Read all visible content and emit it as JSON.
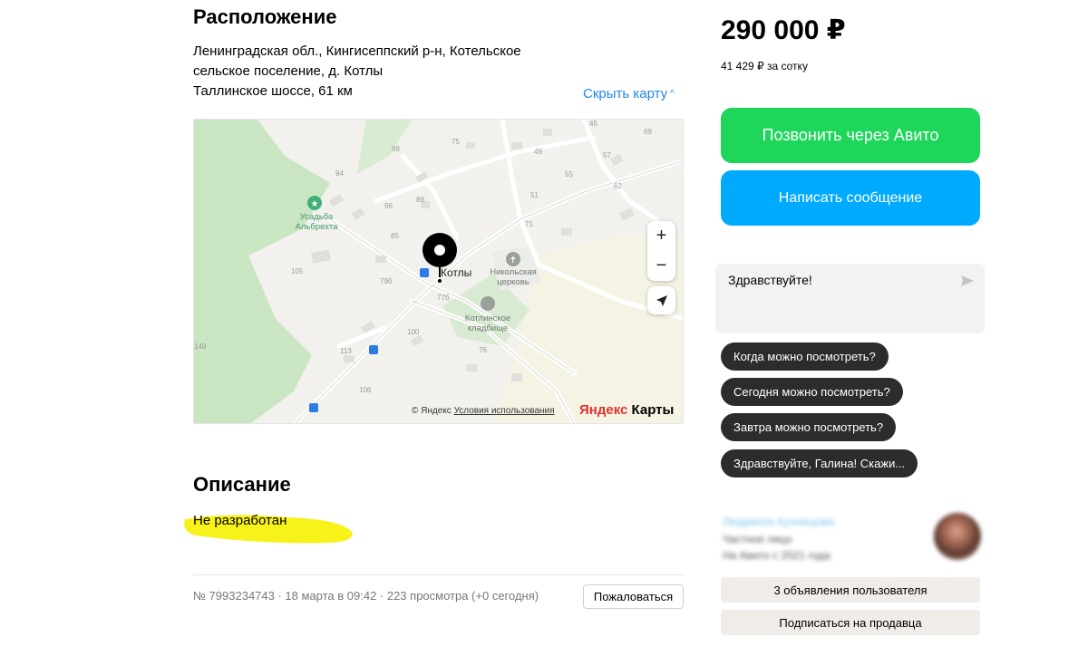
{
  "location": {
    "title": "Расположение",
    "address_line1": "Ленинградская обл., Кингисеппский р-н, Котельское",
    "address_line2": "сельское поселение, д. Котлы",
    "road": "Таллинское шоссе, 61 км",
    "hide_map_link": "Скрыть карту"
  },
  "map": {
    "place_labels": {
      "estate": "Усадьба\nАльбрехта",
      "church": "Никольская\nцерковь",
      "cemetery": "Котлинское\nкладбище",
      "village": "Котлы"
    },
    "house_numbers": [
      "45",
      "75",
      "88",
      "49",
      "57",
      "69",
      "94",
      "55",
      "62",
      "89",
      "51",
      "96",
      "71",
      "85",
      "105",
      "79б",
      "77б",
      "100",
      "149",
      "113",
      "76",
      "106"
    ],
    "zoom_in": "+",
    "zoom_out": "−",
    "copyright": "© Яндекс",
    "terms_link": "Условия использования",
    "logo_part1": "Яндекс",
    "logo_part2": "Карты"
  },
  "description": {
    "title": "Описание",
    "text": "Не разработан"
  },
  "footer": {
    "meta": "№ 7993234743 · 18 марта в 09:42 · 223 просмотра (+0 сегодня)",
    "report_button": "Пожаловаться"
  },
  "sidebar": {
    "price": "290 000 ₽",
    "price_per_unit": "41 429 ₽ за сотку",
    "call_button": "Позвонить через Авито",
    "message_button": "Написать сообщение",
    "chat_text": "Здравствуйте!",
    "quick_replies": [
      "Когда можно посмотреть?",
      "Сегодня можно посмотреть?",
      "Завтра можно посмотреть?",
      "Здравствуйте, Галина! Скажи..."
    ],
    "seller": {
      "name": "Людмила Кузнецова",
      "type": "Частное лицо",
      "since": "На Авито с 2021 года"
    },
    "user_ads_button": "3 объявления пользователя",
    "subscribe_button": "Подписаться на продавца"
  },
  "colors": {
    "call_green": "#1ed65a",
    "message_blue": "#00aaff",
    "link_blue": "#1e88e5",
    "highlight_yellow": "#f7f21a",
    "chip_dark": "#2c2c2c"
  },
  "icons": {
    "pin": "map-pin-icon",
    "locate": "navigation-arrow-icon",
    "send": "send-icon"
  }
}
